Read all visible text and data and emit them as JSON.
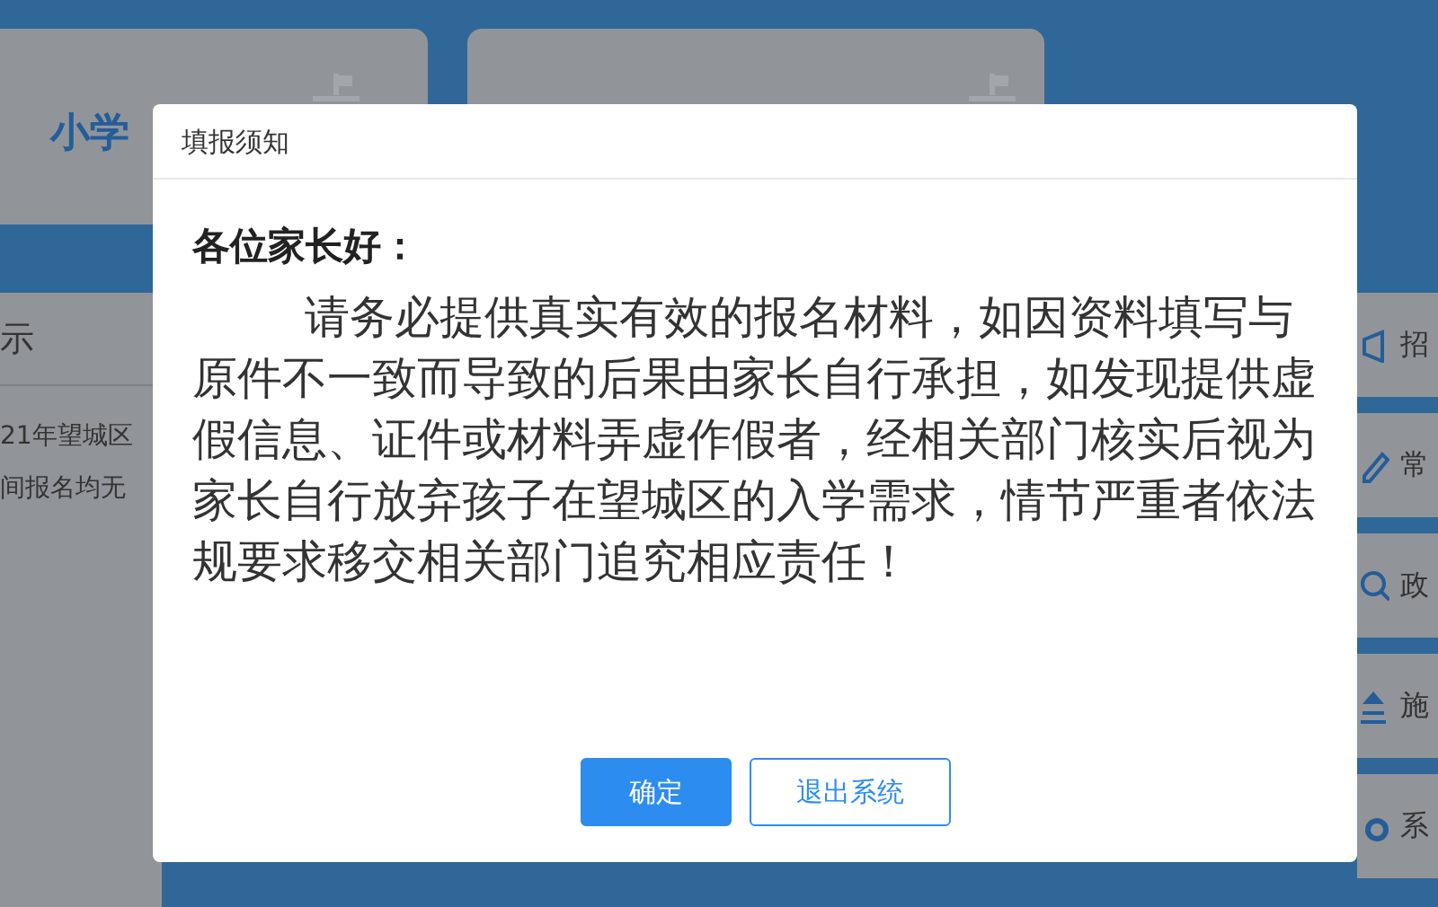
{
  "background": {
    "cards": [
      {
        "kind": "titled",
        "title": "小学"
      },
      {
        "kind": "plain"
      }
    ],
    "notice_panel": {
      "heading": "示",
      "lines": [
        "21年望城区",
        "间报名均无"
      ]
    },
    "side_menu": [
      {
        "label": "招"
      },
      {
        "label": "常"
      },
      {
        "label": "政"
      },
      {
        "label": "施"
      },
      {
        "label": "系"
      }
    ]
  },
  "dialog": {
    "title": "填报须知",
    "greeting": "各位家长好：",
    "message": "请务必提供真实有效的报名材料，如因资料填写与原件不一致而导致的后果由家长自行承担，如发现提供虚假信息、证件或材料弄虚作假者，经相关部门核实后视为家长自行放弃孩子在望城区的入学需求，情节严重者依法规要求移交相关部门追究相应责任！",
    "buttons": [
      {
        "label": "确定",
        "kind": "primary"
      },
      {
        "label": "退出系统",
        "kind": "secondary"
      }
    ]
  }
}
